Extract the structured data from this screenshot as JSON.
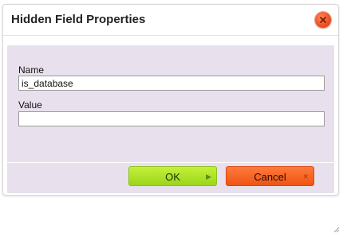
{
  "dialog": {
    "title": "Hidden Field Properties",
    "close_icon": "close-icon"
  },
  "form": {
    "name_label": "Name",
    "name_value": "is_database",
    "value_label": "Value",
    "value_value": ""
  },
  "buttons": {
    "ok_label": "OK",
    "ok_icon": "arrow-right-icon",
    "cancel_label": "Cancel",
    "cancel_icon": "x-icon"
  },
  "colors": {
    "panel_background": "#e8e0ec",
    "ok_button": "#a8e020",
    "cancel_button": "#f05a1a",
    "close_button": "#f0522a"
  }
}
